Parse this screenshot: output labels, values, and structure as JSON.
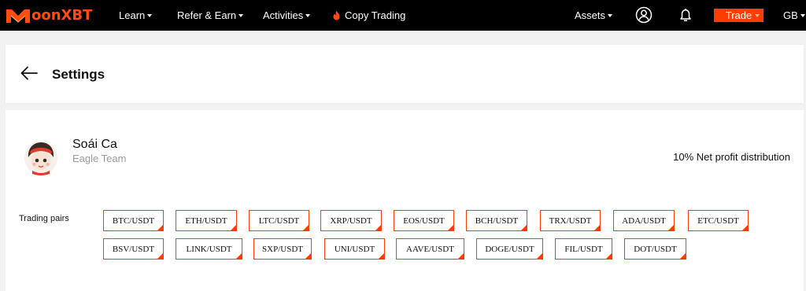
{
  "brand": {
    "name": "oonXBT",
    "accent": "#ff3d00"
  },
  "nav": {
    "learn": "Learn",
    "refer": "Refer & Earn",
    "activities": "Activities",
    "copy_trading": "Copy Trading",
    "assets": "Assets",
    "trade": "Trade",
    "region": "GB"
  },
  "header": {
    "title": "Settings"
  },
  "trader": {
    "name": "Soái Ca",
    "team": "Eagle Team",
    "profit_distribution": "10% Net profit distribution"
  },
  "trading_pairs": {
    "label": "Trading pairs",
    "row1": [
      "BTC/USDT",
      "ETH/USDT",
      "LTC/USDT",
      "XRP/USDT",
      "EOS/USDT",
      "BCH/USDT",
      "TRX/USDT",
      "ADA/USDT",
      "ETC/USDT"
    ],
    "row2": [
      "BSV/USDT",
      "LINK/USDT",
      "SXP/USDT",
      "UNI/USDT",
      "AAVE/USDT",
      "DOGE/USDT",
      "FIL/USDT",
      "DOT/USDT"
    ]
  }
}
